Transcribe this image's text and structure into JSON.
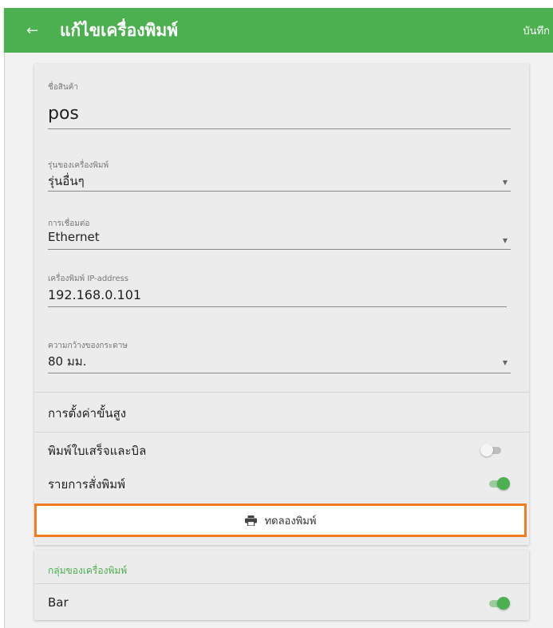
{
  "header": {
    "back_icon": "arrow-left-icon",
    "back_glyph": "←",
    "title": "แก้ไขเครื่องพิมพ์",
    "save_label": "บันทึก"
  },
  "form": {
    "name": {
      "label": "ชื่อสินค้า",
      "value": "pos"
    },
    "model": {
      "label": "รุ่นของเครื่องพิมพ์",
      "value": "รุ่นอื่นๆ"
    },
    "connection": {
      "label": "การเชื่อมต่อ",
      "value": "Ethernet"
    },
    "ip": {
      "label": "เครื่องพิมพ์ IP-address",
      "value": "192.168.0.101"
    },
    "paper": {
      "label": "ความกว้างของกระดาษ",
      "value": "80 มม."
    }
  },
  "advanced": {
    "title": "การตั้งค่าขั้นสูง",
    "receipts": {
      "label": "พิมพ์ใบเสร็จและบิล",
      "on": false
    },
    "orders": {
      "label": "รายการสั่งพิมพ์",
      "on": true
    }
  },
  "test_button": {
    "label": "ทดลองพิมพ์",
    "icon": "printer-icon"
  },
  "groups": {
    "title": "กลุ่มของเครื่องพิมพ์",
    "items": [
      {
        "label": "Bar",
        "on": true
      }
    ]
  },
  "colors": {
    "primary": "#4caf50",
    "highlight": "#ee7d22"
  }
}
